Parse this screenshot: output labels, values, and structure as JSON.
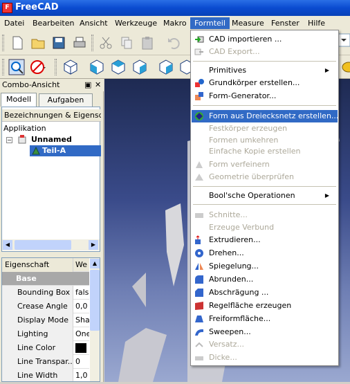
{
  "window": {
    "title": "FreeCAD"
  },
  "menubar": [
    "Datei",
    "Bearbeiten",
    "Ansicht",
    "Werkzeuge",
    "Makro",
    "Formteil",
    "Measure",
    "Fenster",
    "Hilfe"
  ],
  "combo": {
    "title": "Combo-Ansicht",
    "tabs": [
      "Modell",
      "Aufgaben"
    ]
  },
  "tree": {
    "header": "Bezeichnungen & Eigenschaften",
    "root": "Applikation",
    "document": "Unnamed",
    "part": "Teil-A"
  },
  "props": {
    "col_name": "Eigenschaft",
    "col_value": "We",
    "group": "Base",
    "rows": [
      {
        "name": "Bounding Box",
        "value": "fals"
      },
      {
        "name": "Crease Angle",
        "value": "0,0"
      },
      {
        "name": "Display Mode",
        "value": "Sha"
      },
      {
        "name": "Lighting",
        "value": "One"
      },
      {
        "name": "Line Color",
        "value": ""
      },
      {
        "name": "Line Transpar...",
        "value": "0"
      },
      {
        "name": "Line Width",
        "value": "1,0"
      }
    ]
  },
  "formteil_menu": {
    "items": [
      {
        "label": "CAD importieren ...",
        "enabled": true,
        "icon": "import-icon"
      },
      {
        "label": "CAD Export...",
        "enabled": false,
        "icon": "export-icon"
      },
      {
        "label": "Primitives",
        "enabled": true,
        "submenu": true
      },
      {
        "label": "Grundkörper erstellen...",
        "enabled": true,
        "icon": "primitives-icon"
      },
      {
        "label": "Form-Generator...",
        "enabled": true,
        "icon": "shape-builder-icon"
      },
      {
        "label": "Form aus Dreiecksnetz erstellen...",
        "enabled": true,
        "highlighted": true,
        "icon": "mesh-shape-icon"
      },
      {
        "label": "Festkörper erzeugen",
        "enabled": false
      },
      {
        "label": "Formen umkehren",
        "enabled": false
      },
      {
        "label": "Einfache Kopie erstellen",
        "enabled": false
      },
      {
        "label": "Form verfeinern",
        "enabled": false,
        "icon": "refine-icon"
      },
      {
        "label": "Geometrie überprüfen",
        "enabled": false,
        "icon": "check-geometry-icon"
      },
      {
        "label": "Bool'sche Operationen",
        "enabled": true,
        "submenu": true
      },
      {
        "label": "Schnitte...",
        "enabled": false,
        "icon": "section-icon"
      },
      {
        "label": "Erzeuge Verbund",
        "enabled": false
      },
      {
        "label": "Extrudieren...",
        "enabled": true,
        "icon": "extrude-icon"
      },
      {
        "label": "Drehen...",
        "enabled": true,
        "icon": "revolve-icon"
      },
      {
        "label": "Spiegelung...",
        "enabled": true,
        "icon": "mirror-icon"
      },
      {
        "label": "Abrunden...",
        "enabled": true,
        "icon": "fillet-icon"
      },
      {
        "label": "Abschrägung ...",
        "enabled": true,
        "icon": "chamfer-icon"
      },
      {
        "label": "Regelfläche erzeugen",
        "enabled": true,
        "icon": "ruled-surface-icon"
      },
      {
        "label": "Freiformfläche...",
        "enabled": true,
        "icon": "loft-icon"
      },
      {
        "label": "Sweepen...",
        "enabled": true,
        "icon": "sweep-icon"
      },
      {
        "label": "Versatz...",
        "enabled": false,
        "icon": "offset-icon"
      },
      {
        "label": "Dicke...",
        "enabled": false,
        "icon": "thickness-icon"
      }
    ]
  },
  "colors": {
    "title_bar": "#0a4bd0",
    "highlight": "#316ac5",
    "menu_bg": "#ece9d8"
  }
}
